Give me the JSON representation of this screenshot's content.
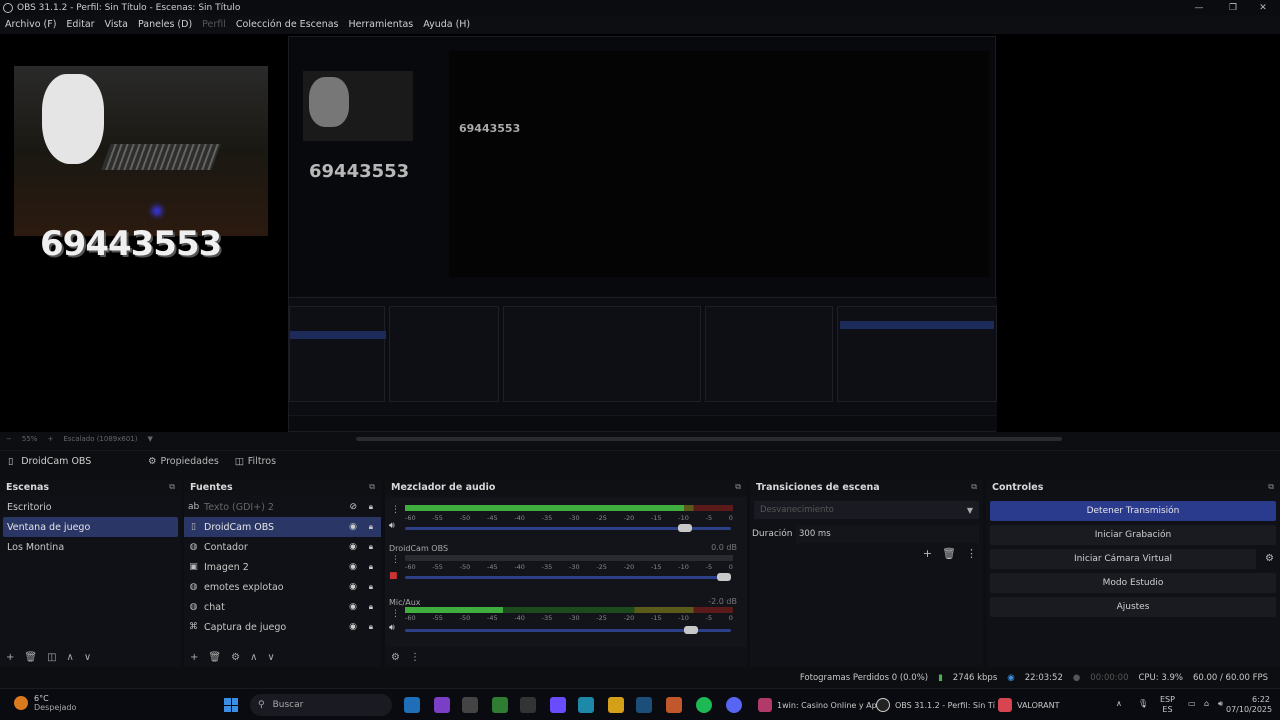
{
  "titlebar": {
    "title": "OBS 31.1.2 - Perfil: Sin Título - Escenas: Sin Título",
    "min": "—",
    "max": "❐",
    "close": "✕"
  },
  "menu": [
    "Archivo (F)",
    "Editar",
    "Vista",
    "Paneles (D)",
    "Perfil",
    "Colección de Escenas",
    "Herramientas",
    "Ayuda (H)"
  ],
  "preview": {
    "counter": "69443553",
    "counter_nested": "69443553"
  },
  "zoombar": {
    "zoom": "55%",
    "scaled": "Escalado (1089x601)"
  },
  "source_toolbar": {
    "source_name": "DroidCam OBS",
    "properties": "Propiedades",
    "filters": "Filtros"
  },
  "scenes": {
    "title": "Escenas",
    "items": [
      "Escritorio",
      "Ventana de juego",
      "Los Montina"
    ],
    "selected": 1
  },
  "sources": {
    "title": "Fuentes",
    "items": [
      {
        "label": "Texto (GDI+) 2",
        "icon": "text-icon",
        "hidden": true
      },
      {
        "label": "DroidCam OBS",
        "icon": "source-icon",
        "hidden": false
      },
      {
        "label": "Contador",
        "icon": "browser-icon",
        "hidden": false
      },
      {
        "label": "Imagen 2",
        "icon": "image-icon",
        "hidden": false
      },
      {
        "label": "emotes explotao",
        "icon": "browser-icon",
        "hidden": false
      },
      {
        "label": "chat",
        "icon": "browser-icon",
        "hidden": false
      },
      {
        "label": "Captura de juego",
        "icon": "gamepad-icon",
        "hidden": false
      }
    ],
    "selected": 1
  },
  "mixer": {
    "title": "Mezclador de audio",
    "scale": [
      "-60",
      "-55",
      "-50",
      "-45",
      "-40",
      "-35",
      "-30",
      "-25",
      "-20",
      "-15",
      "-10",
      "-5",
      "0"
    ],
    "channels": [
      {
        "name": "",
        "db": "",
        "level": 0.85,
        "volume": 0.88
      },
      {
        "name": "DroidCam OBS",
        "db": "0.0 dB",
        "level": 0.0,
        "volume": 1.0
      },
      {
        "name": "Mic/Aux",
        "db": "-2.0 dB",
        "level": 0.3,
        "volume": 0.9
      }
    ]
  },
  "transitions": {
    "title": "Transiciones de escena",
    "selected": "Desvanecimiento",
    "duration_label": "Duración",
    "duration": "300 ms"
  },
  "controls": {
    "title": "Controles",
    "stop_stream": "Detener Transmisión",
    "start_record": "Iniciar Grabación",
    "virtual_cam": "Iniciar Cámara Virtual",
    "studio_mode": "Modo Estudio",
    "settings": "Ajustes"
  },
  "status": {
    "dropped": "Fotogramas Perdidos 0 (0.0%)",
    "bitrate": "2746 kbps",
    "stream_time": "22:03:52",
    "rec_time": "00:00:00",
    "cpu": "CPU: 3.9%",
    "fps": "60.00 / 60.00 FPS"
  },
  "taskbar": {
    "temp": "6°C",
    "weather": "Despejado",
    "search": "Buscar",
    "app1": "1win: Casino Online y Ap",
    "app2": "OBS 31.1.2 - Perfil: Sin Tí",
    "app3": "VALORANT",
    "lang1": "ESP",
    "lang2": "ES",
    "time": "6:22",
    "date": "07/10/2025"
  },
  "colors": {
    "accent": "#2a3666",
    "primary_button": "#2a3a8c"
  }
}
